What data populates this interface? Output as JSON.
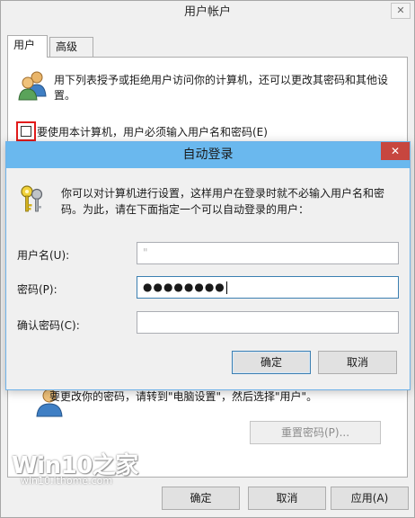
{
  "main": {
    "title": "用户帐户",
    "close_glyph": "✕",
    "tabs": [
      {
        "label": "用户"
      },
      {
        "label": "高级"
      }
    ],
    "intro": "用下列表授予或拒绝用户访问你的计算机，还可以更改其密码和其他设置。",
    "require_login_label": "要使用本计算机，用户必须输入用户名和密码(E)",
    "behind_text": "要更改你的密码，请转到\"电脑设置\"，然后选择\"用户\"。",
    "reset_password_label": "重置密码(P)...",
    "buttons": {
      "ok": "确定",
      "cancel": "取消",
      "apply": "应用(A)"
    },
    "icons": {
      "users": "users-icon",
      "user": "user-icon"
    }
  },
  "watermark": {
    "logo": "Win10之家",
    "url": "win10.ithome.com"
  },
  "autologon": {
    "title": "自动登录",
    "close_glyph": "✕",
    "description": "你可以对计算机进行设置，这样用户在登录时就不必输入用户名和密码。为此，请在下面指定一个可以自动登录的用户：",
    "fields": {
      "username_label": "用户名(U):",
      "username_value": "\"",
      "password_label": "密码(P):",
      "password_value": "●●●●●●●●",
      "confirm_label": "确认密码(C):",
      "confirm_value": ""
    },
    "buttons": {
      "ok": "确定",
      "cancel": "取消"
    },
    "icons": {
      "keys": "keys-icon"
    },
    "colors": {
      "titlebar": "#6ab8ee",
      "close": "#c7463f",
      "focus_border": "#3c7fb1"
    }
  },
  "colors": {
    "highlight_box": "#e21b1b",
    "window_bg": "#f0f0f0"
  }
}
